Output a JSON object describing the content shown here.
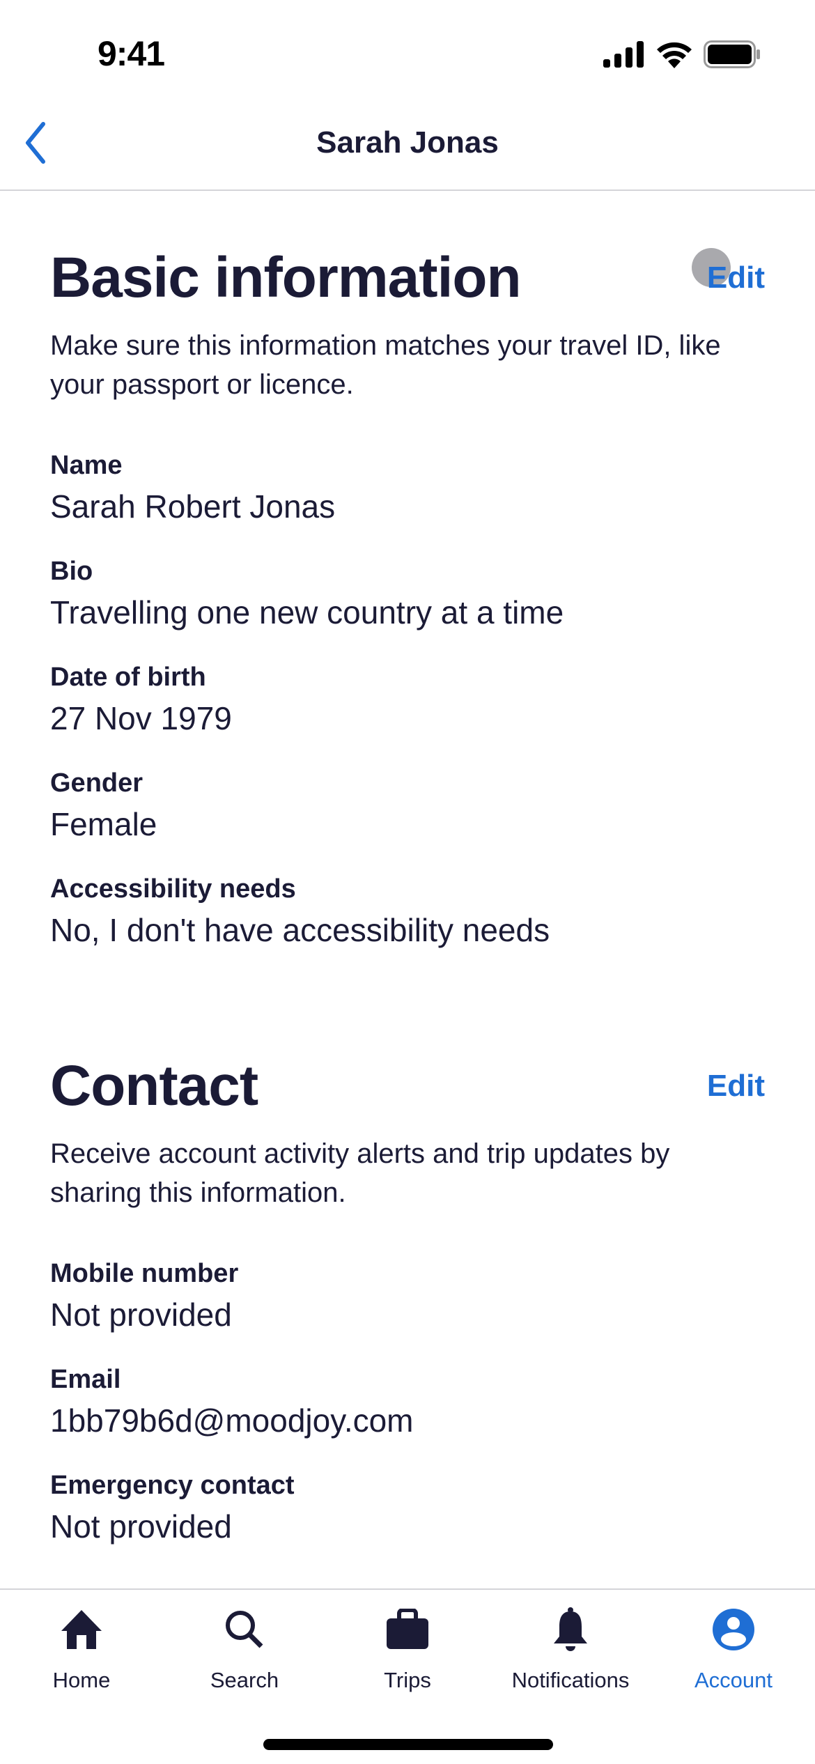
{
  "status_bar": {
    "time": "9:41"
  },
  "header": {
    "title": "Sarah Jonas",
    "back_icon": "chevron-left-icon"
  },
  "sections": {
    "basic": {
      "title": "Basic information",
      "edit_label": "Edit",
      "description": "Make sure this information matches your travel ID, like your passport or licence.",
      "fields": [
        {
          "label": "Name",
          "value": "Sarah Robert Jonas"
        },
        {
          "label": "Bio",
          "value": "Travelling one new country at a time"
        },
        {
          "label": "Date of birth",
          "value": "27 Nov 1979"
        },
        {
          "label": "Gender",
          "value": "Female"
        },
        {
          "label": "Accessibility needs",
          "value": "No, I don't have accessibility needs"
        }
      ]
    },
    "contact": {
      "title": "Contact",
      "edit_label": "Edit",
      "description": "Receive account activity alerts and trip updates by sharing this information.",
      "fields": [
        {
          "label": "Mobile number",
          "value": "Not provided"
        },
        {
          "label": "Email",
          "value": "1bb79b6d@moodjoy.com"
        },
        {
          "label": "Emergency contact",
          "value": "Not provided"
        }
      ]
    }
  },
  "tab_bar": {
    "active": "Account",
    "items": [
      {
        "label": "Home",
        "icon": "home-icon"
      },
      {
        "label": "Search",
        "icon": "search-icon"
      },
      {
        "label": "Trips",
        "icon": "briefcase-icon"
      },
      {
        "label": "Notifications",
        "icon": "bell-icon"
      },
      {
        "label": "Account",
        "icon": "account-icon"
      }
    ]
  },
  "colors": {
    "accent": "#1f6ed4",
    "text": "#1b1b36",
    "divider": "#d4d4d8"
  }
}
